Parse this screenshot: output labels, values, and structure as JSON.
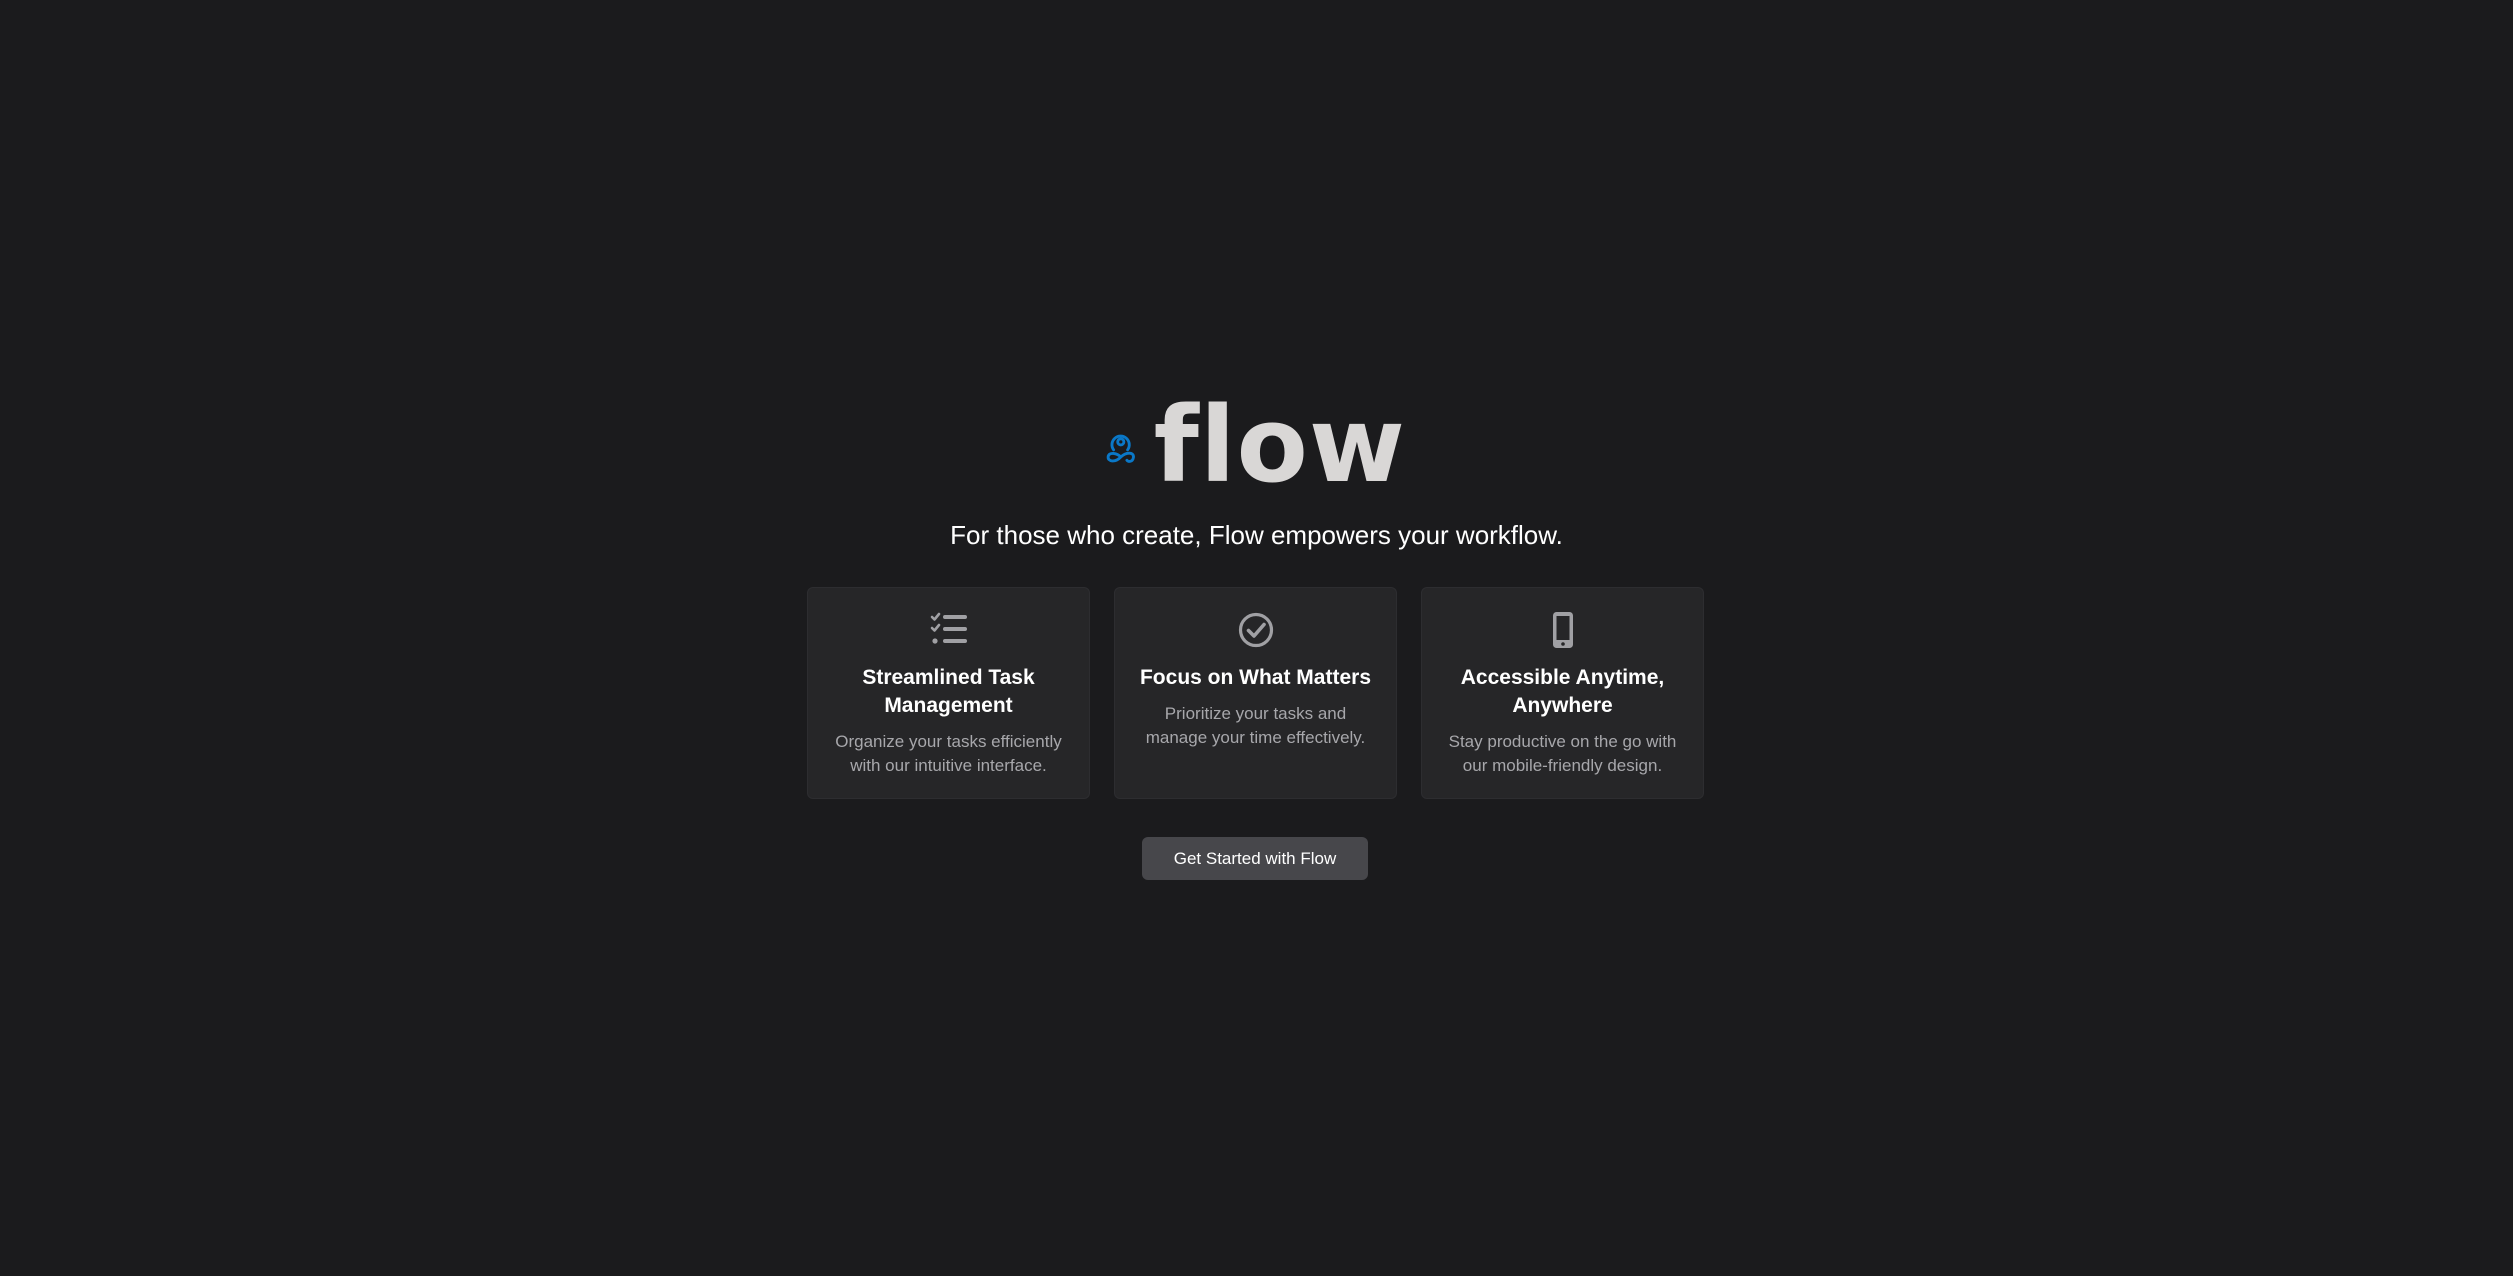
{
  "brand": {
    "logo_icon": "meditation-figure-icon",
    "name": "flow",
    "accent_color": "#0a78c8"
  },
  "hero": {
    "tagline": "For those who create, Flow empowers your workflow."
  },
  "features": [
    {
      "icon": "task-list-icon",
      "title": "Streamlined Task Management",
      "description": "Organize your tasks efficiently with our intuitive interface."
    },
    {
      "icon": "check-circle-icon",
      "title": "Focus on What Matters",
      "description": "Prioritize your tasks and manage your time effectively."
    },
    {
      "icon": "mobile-phone-icon",
      "title": "Accessible Anytime, Anywhere",
      "description": "Stay productive on the go with our mobile-friendly design."
    }
  ],
  "cta": {
    "label": "Get Started with Flow"
  }
}
